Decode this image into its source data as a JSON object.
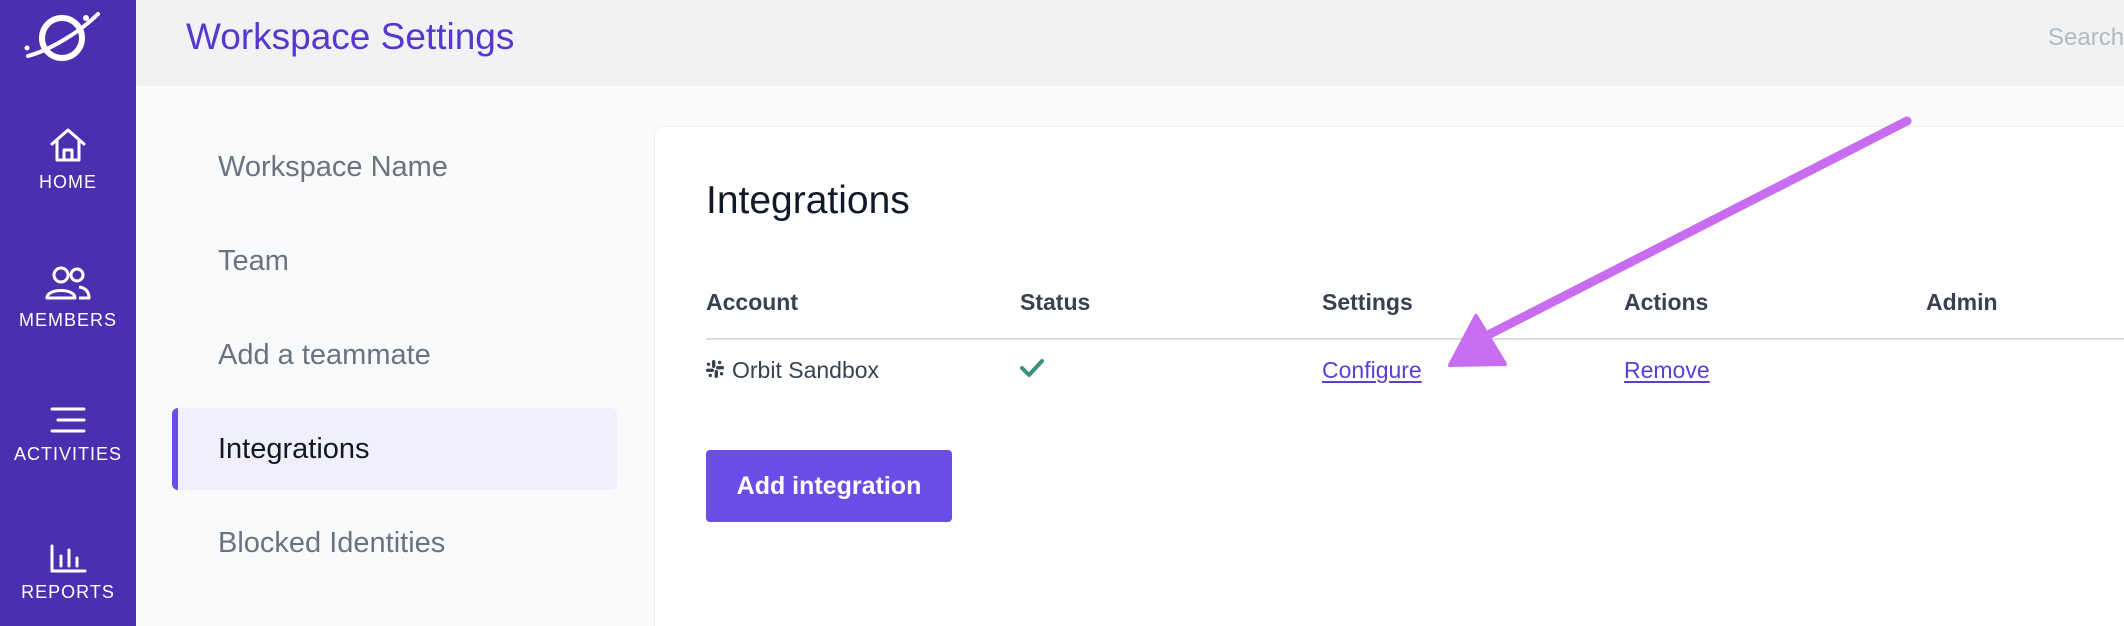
{
  "nav": {
    "items": [
      {
        "label": "HOME",
        "icon": "home-icon"
      },
      {
        "label": "MEMBERS",
        "icon": "members-icon"
      },
      {
        "label": "ACTIVITIES",
        "icon": "activities-icon"
      },
      {
        "label": "REPORTS",
        "icon": "reports-icon"
      }
    ]
  },
  "header": {
    "title": "Workspace Settings",
    "search_placeholder": "Search"
  },
  "settings_menu": {
    "items": [
      {
        "label": "Workspace Name",
        "active": false
      },
      {
        "label": "Team",
        "active": false
      },
      {
        "label": "Add a teammate",
        "active": false
      },
      {
        "label": "Integrations",
        "active": true
      },
      {
        "label": "Blocked Identities",
        "active": false
      }
    ]
  },
  "integrations": {
    "title": "Integrations",
    "columns": [
      "Account",
      "Status",
      "Settings",
      "Actions",
      "Admin"
    ],
    "rows": [
      {
        "account": "Orbit Sandbox",
        "account_icon": "slack-icon",
        "status_icon": "check-icon",
        "settings_link": "Configure",
        "actions_link": "Remove",
        "admin": ""
      }
    ],
    "add_button": "Add integration"
  },
  "colors": {
    "rail": "#4c2fb0",
    "accent": "#6a4de7",
    "title": "#5737d0",
    "status_ok": "#3f8f7f",
    "annotation_arrow": "#c86cf0"
  }
}
